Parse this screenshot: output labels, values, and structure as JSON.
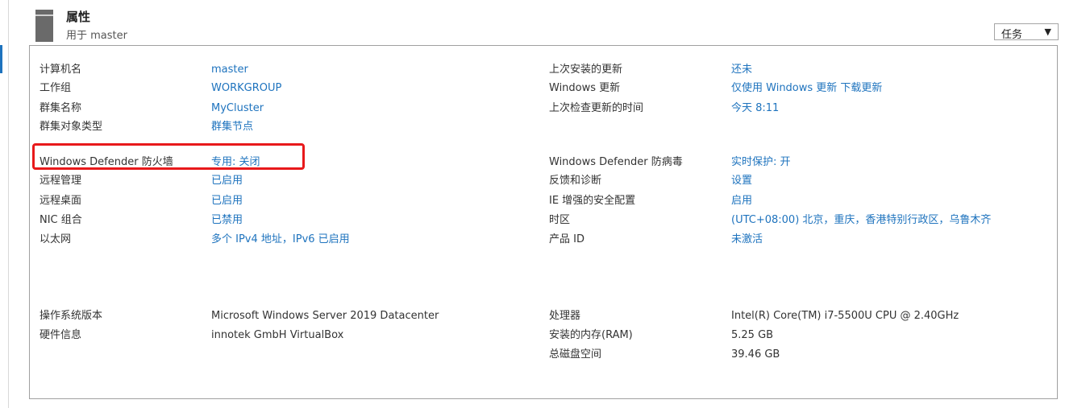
{
  "header": {
    "title": "属性",
    "subtitle": "用于 master",
    "tasks_label": "任务",
    "tasks_arrow": "▼"
  },
  "left": {
    "group1": [
      {
        "label": "计算机名",
        "value": "master"
      },
      {
        "label": "工作组",
        "value": "WORKGROUP"
      },
      {
        "label": "群集名称",
        "value": "MyCluster"
      },
      {
        "label": "群集对象类型",
        "value": "群集节点"
      }
    ],
    "group2": [
      {
        "label": "Windows Defender 防火墙",
        "value": "专用: 关闭"
      },
      {
        "label": "远程管理",
        "value": "已启用"
      },
      {
        "label": "远程桌面",
        "value": "已启用"
      },
      {
        "label": "NIC 组合",
        "value": "已禁用"
      },
      {
        "label": "以太网",
        "value": "多个 IPv4 地址，IPv6 已启用"
      }
    ],
    "group3": [
      {
        "label": "操作系统版本",
        "value": "Microsoft Windows Server 2019 Datacenter"
      },
      {
        "label": "硬件信息",
        "value": "innotek GmbH VirtualBox"
      }
    ]
  },
  "right": {
    "group1": [
      {
        "label": "上次安装的更新",
        "value": "还未"
      },
      {
        "label": "Windows 更新",
        "value": "仅使用 Windows 更新 下载更新"
      },
      {
        "label": "上次检查更新的时间",
        "value": "今天 8:11"
      }
    ],
    "group2": [
      {
        "label": "Windows Defender 防病毒",
        "value": "实时保护: 开"
      },
      {
        "label": "反馈和诊断",
        "value": "设置"
      },
      {
        "label": "IE 增强的安全配置",
        "value": "启用"
      },
      {
        "label": "时区",
        "value": "(UTC+08:00) 北京，重庆，香港特别行政区，乌鲁木齐"
      },
      {
        "label": "产品 ID",
        "value": "未激活"
      }
    ],
    "group3": [
      {
        "label": "处理器",
        "value": "Intel(R) Core(TM) i7-5500U CPU @ 2.40GHz"
      },
      {
        "label": "安装的内存(RAM)",
        "value": "5.25 GB"
      },
      {
        "label": "总磁盘空间",
        "value": "39.46 GB"
      }
    ]
  },
  "colors": {
    "link": "#1e73be",
    "highlight": "#e8191b"
  }
}
